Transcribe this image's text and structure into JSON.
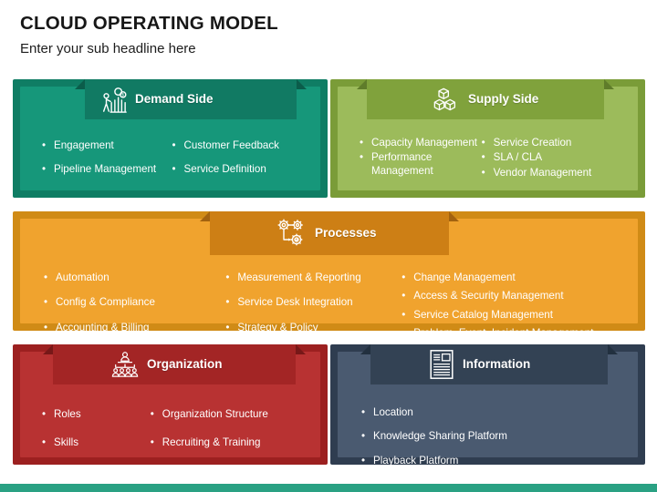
{
  "header": {
    "title": "CLOUD OPERATING MODEL",
    "subtitle": "Enter your sub headline here"
  },
  "theme": {
    "bottom_bar_color": "#2aa183",
    "page_background": "#ffffff",
    "title_color": "#171717"
  },
  "panels": [
    {
      "id": "demand-side",
      "title": "Demand Side",
      "icon": "person-growth-chart-icon",
      "frame_color": "#0f7d64",
      "body_color": "#16977a",
      "ribbon_color": "#117a63",
      "ribbon_fold_color": "#0b5c4a",
      "columns": [
        {
          "items": [
            "Engagement",
            "Pipeline Management"
          ]
        },
        {
          "items": [
            "Customer Feedback",
            "Service Definition"
          ]
        }
      ]
    },
    {
      "id": "supply-side",
      "title": "Supply Side",
      "icon": "stacked-boxes-icon",
      "frame_color": "#7a9c38",
      "body_color": "#9cbb5b",
      "ribbon_color": "#80a23c",
      "ribbon_fold_color": "#5f7c2a",
      "columns": [
        {
          "items": [
            "Capacity Management",
            "Performance Management"
          ]
        },
        {
          "items": [
            "Service Creation",
            "SLA / CLA",
            "Vendor Management"
          ]
        }
      ]
    },
    {
      "id": "processes",
      "title": "Processes",
      "icon": "gears-process-icon",
      "frame_color": "#d08b16",
      "body_color": "#f0a32e",
      "ribbon_color": "#cd7f15",
      "ribbon_fold_color": "#a2620f",
      "columns": [
        {
          "items": [
            "Automation",
            "Config & Compliance",
            "Accounting & Billing"
          ]
        },
        {
          "items": [
            "Measurement & Reporting",
            "Service Desk Integration",
            "Strategy & Policy"
          ]
        },
        {
          "items": [
            "Change Management",
            "Access & Security Management",
            "Service Catalog Management",
            "Problem, Event. Incident Management"
          ]
        }
      ]
    },
    {
      "id": "organization",
      "title": "Organization",
      "icon": "org-chart-icon",
      "frame_color": "#9c2020",
      "body_color": "#b83232",
      "ribbon_color": "#a32525",
      "ribbon_fold_color": "#771818",
      "columns": [
        {
          "items": [
            "Roles",
            "Skills"
          ]
        },
        {
          "items": [
            "Organization Structure",
            "Recruiting & Training"
          ]
        }
      ]
    },
    {
      "id": "information",
      "title": "Information",
      "icon": "document-lines-icon",
      "frame_color": "#2f3d50",
      "body_color": "#4a5a70",
      "ribbon_color": "#334254",
      "ribbon_fold_color": "#22303f",
      "columns": [
        {
          "items": [
            "Location",
            "Knowledge Sharing Platform",
            "Playback Platform"
          ]
        }
      ]
    }
  ]
}
